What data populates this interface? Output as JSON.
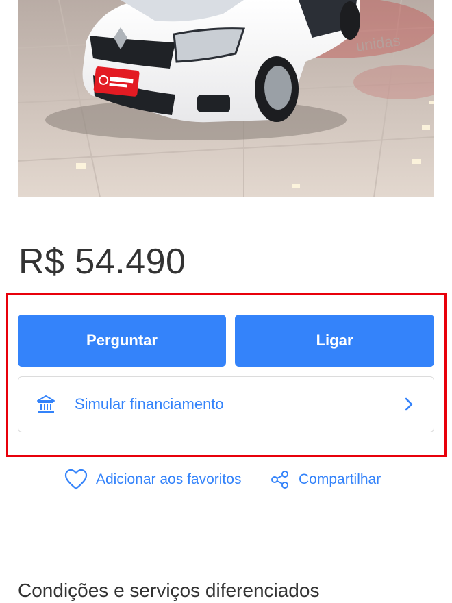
{
  "listing": {
    "price": "R$ 54.490",
    "photo_brand_plate": "unidas seminovos"
  },
  "contact": {
    "ask_label": "Perguntar",
    "call_label": "Ligar"
  },
  "financing": {
    "label": "Simular financiamento",
    "icon": "bank-icon",
    "chevron": "chevron-right-icon"
  },
  "actions": {
    "favorite_label": "Adicionar aos favoritos",
    "favorite_icon": "heart-icon",
    "share_label": "Compartilhar",
    "share_icon": "share-icon"
  },
  "section": {
    "title": "Condições e serviços diferenciados"
  },
  "colors": {
    "primary": "#3483fa",
    "highlight": "#e8000b",
    "text": "#333333",
    "plate_red": "#e31b23"
  }
}
